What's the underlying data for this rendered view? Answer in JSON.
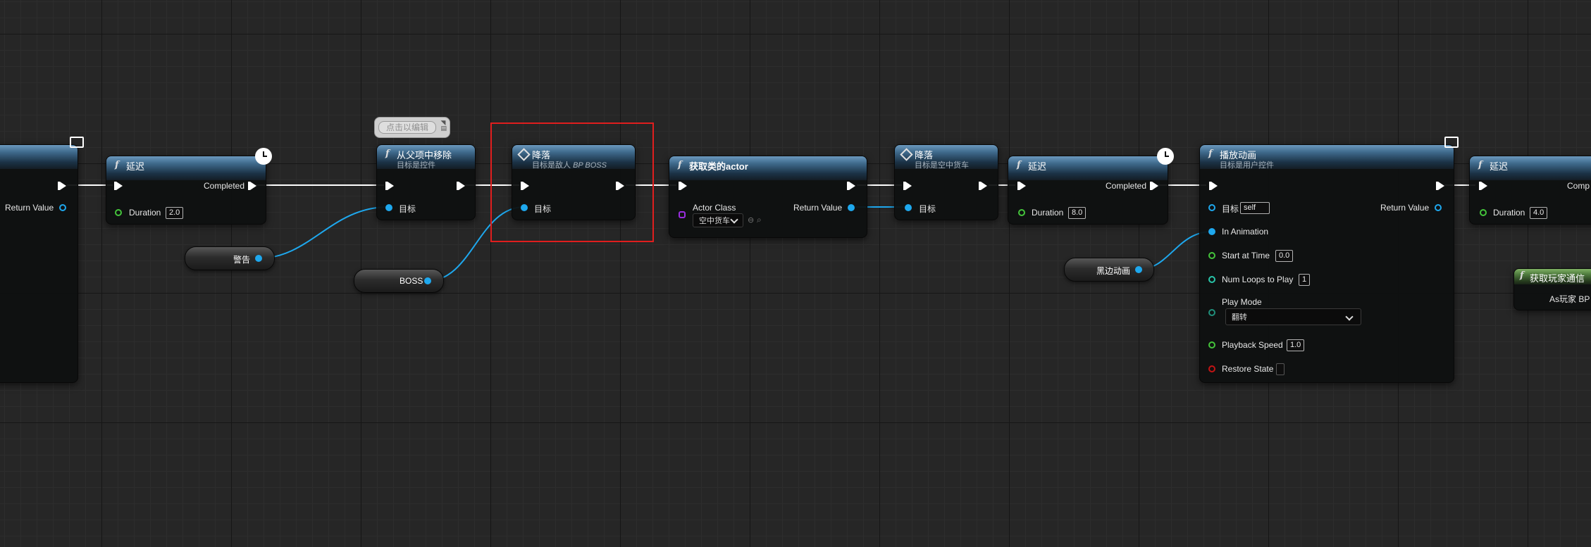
{
  "graph": {
    "comment_bubble": {
      "text": "点击以编辑"
    },
    "node_left": {
      "return_label": "Return Value"
    },
    "node_delay_1": {
      "title": "延迟",
      "completed": "Completed",
      "duration_label": "Duration",
      "duration_value": "2.0"
    },
    "node_remove": {
      "title": "从父项中移除",
      "subtitle": "目标是控件",
      "target_label": "目标"
    },
    "node_land_1": {
      "title": "降落",
      "subtitle_prefix": "目标是敌人 ",
      "subtitle_class": "BP BOSS",
      "target_label": "目标"
    },
    "node_get_actor": {
      "title": "获取类的actor",
      "actor_class_label": "Actor Class",
      "actor_class_value": "空中货车",
      "return_label": "Return Value"
    },
    "node_land_2": {
      "title": "降落",
      "subtitle": "目标是空中货车",
      "target_label": "目标"
    },
    "node_delay_2": {
      "title": "延迟",
      "completed": "Completed",
      "duration_label": "Duration",
      "duration_value": "8.0"
    },
    "node_play_anim": {
      "title": "播放动画",
      "subtitle": "目标是用户控件",
      "target_label": "目标",
      "target_value": "self",
      "return_label": "Return Value",
      "in_animation_label": "In Animation",
      "start_label": "Start at Time",
      "start_value": "0.0",
      "loops_label": "Num Loops to Play",
      "loops_value": "1",
      "play_mode_label": "Play Mode",
      "play_mode_value": "翻转",
      "speed_label": "Playback Speed",
      "speed_value": "1.0",
      "restore_label": "Restore State"
    },
    "node_delay_3": {
      "title": "延迟",
      "completed": "Comp",
      "duration_label": "Duration",
      "duration_value": "4.0"
    },
    "node_get_player": {
      "title": "获取玩家通信",
      "output_label": "As玩家 BP"
    },
    "var_warning": {
      "label": "警告"
    },
    "var_boss": {
      "label": "BOSS"
    },
    "var_black_anim": {
      "label": "黑边动画"
    }
  },
  "colors": {
    "background": "#262626",
    "exec_wire": "#ffffff",
    "object_pin": "#1ea8ee",
    "float_pin": "#44c43b",
    "int_pin": "#28c6aa",
    "bool_pin": "#c41414",
    "class_pin": "#9a2de0",
    "selection": "#e01e1e"
  },
  "icons": [
    "clock-icon",
    "monitor-icon",
    "function-icon",
    "event-diamond-icon",
    "exec-pin-icon",
    "chevron-down-icon",
    "search-icon",
    "pin-icon"
  ]
}
